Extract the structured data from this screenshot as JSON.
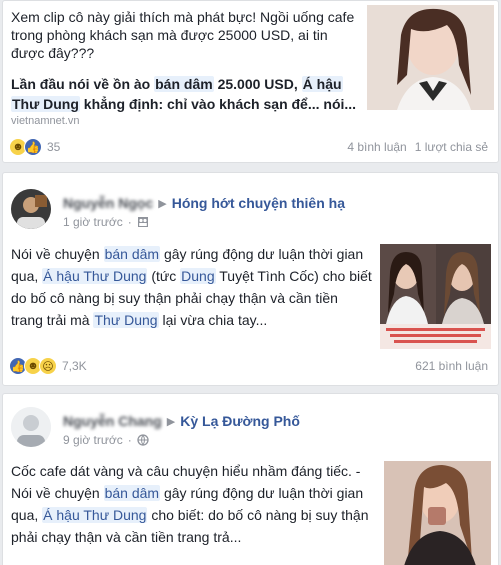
{
  "post1": {
    "text": "Xem clip cô này giải thích mà phát bực! Ngồi uống cafe trong phòng khách sạn mà được 25000 USD, ai tin được đây???",
    "link_title": {
      "part1": "Lần đầu nói về ồn ào ",
      "hl1": "bán dâm",
      "part2": " 25.000 USD, ",
      "hl2": "Á hậu",
      "part3": "",
      "hl3": "Thư Dung",
      "part4": " khẳng định: chỉ vào khách sạn để... nói..."
    },
    "source": "vietnamnet.vn",
    "reaction_count": "35",
    "comments": "4 bình luận",
    "shares": "1 lượt chia sẻ"
  },
  "post2": {
    "author": "Nguyễn Ngọc",
    "group": "Hóng hớt chuyện thiên hạ",
    "time": "1 giờ trước",
    "audience_icon": "group-icon",
    "text": {
      "a": "Nói về chuyện ",
      "hl1": "bán dâm",
      "b": " gây rúng động dư luận thời gian qua, ",
      "hl2": "Á hậu Thư Dung",
      "c": " (tức ",
      "hl3": "Dung",
      "d": " Tuyệt Tình Cốc) cho biết do bố cô nàng bị suy thận phải chạy thận và cần tiền trang trải mà ",
      "hl4": "Thư Dung",
      "e": " lại vừa chia tay..."
    },
    "reaction_count": "7,3K",
    "comments": "621 bình luận"
  },
  "post3": {
    "author": "Nguyễn Chang",
    "group": "Kỳ Lạ Đường Phố",
    "time": "9 giờ trước",
    "audience_icon": "globe-icon",
    "text": {
      "a": "Cốc cafe dát vàng và câu chuyện hiểu nhầm đáng tiếc. - Nói về chuyện ",
      "hl1": "bán dâm",
      "b": " gây rúng động dư luận thời gian qua, ",
      "hl2": "Á hậu Thư Dung",
      "c": " cho biết: do bố cô nàng bị suy thận phải chạy thận và cần tiền trang trả..."
    }
  },
  "colors": {
    "link": "#365899",
    "highlight_bg": "#e7f0fb",
    "meta": "#90949c",
    "like_blue": "#4267b2"
  }
}
